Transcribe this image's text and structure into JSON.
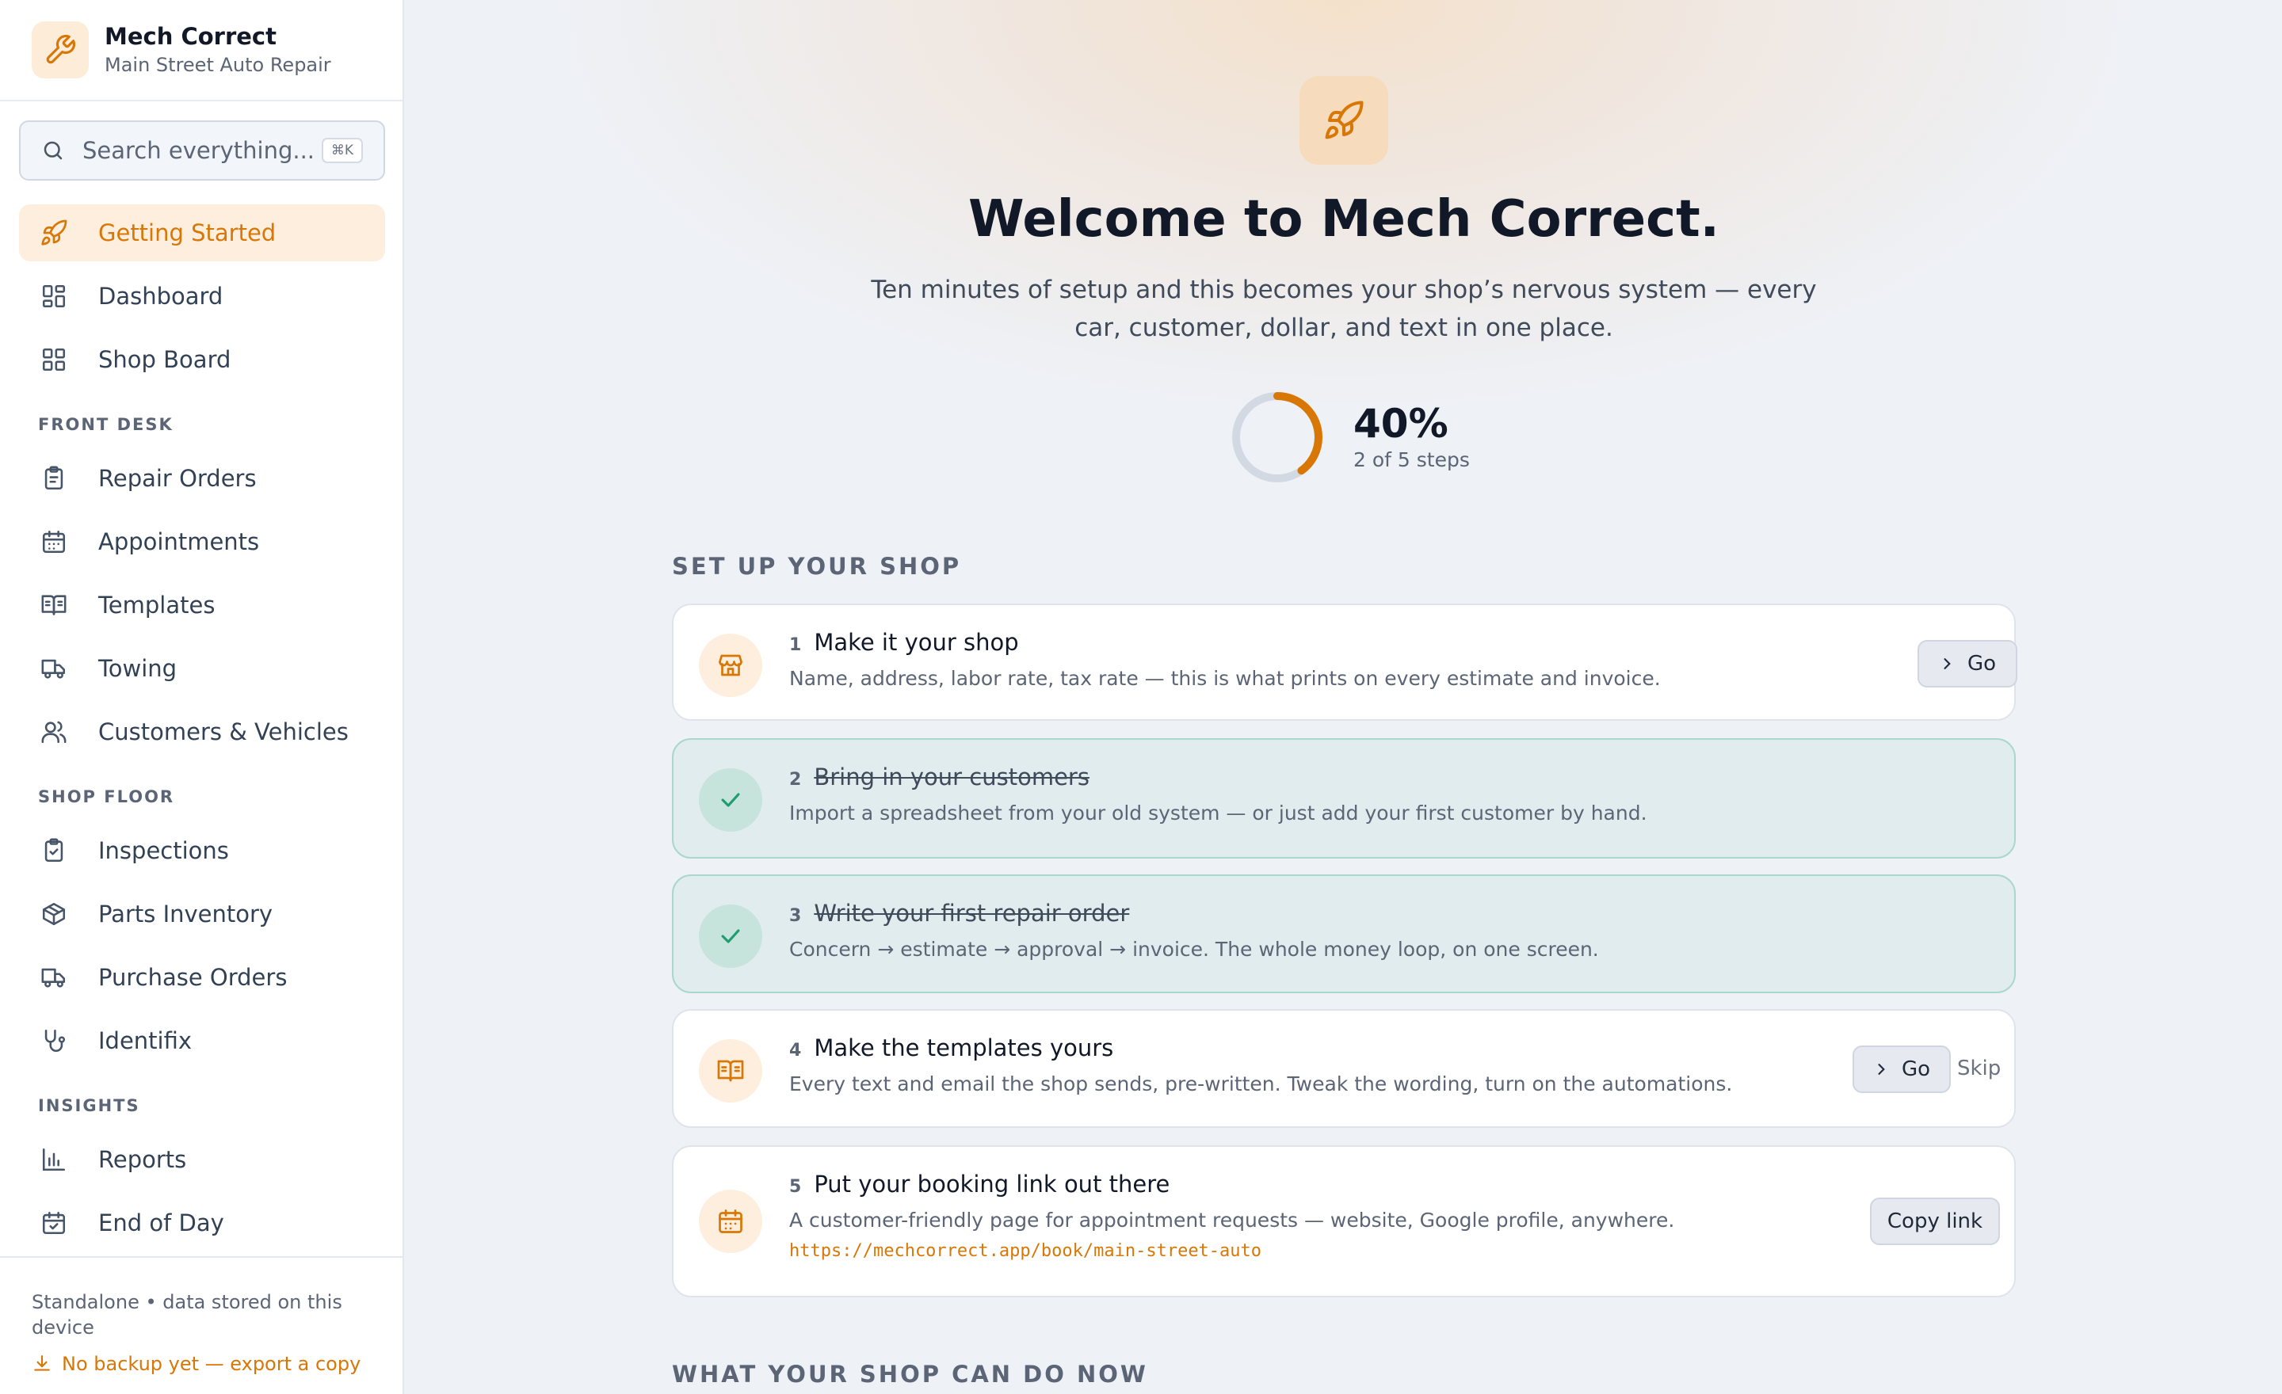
{
  "app": {
    "name": "Mech Correct",
    "shop_name": "Main Street Auto Repair"
  },
  "search": {
    "placeholder": "Search everything...",
    "shortcut": "⌘K"
  },
  "nav": {
    "top": [
      {
        "label": "Getting Started",
        "icon": "rocket-icon",
        "active": true
      },
      {
        "label": "Dashboard",
        "icon": "grid-icon"
      },
      {
        "label": "Shop Board",
        "icon": "grid-icon"
      }
    ],
    "front_desk": {
      "title": "FRONT DESK",
      "items": [
        {
          "label": "Repair Orders",
          "icon": "clipboard-icon"
        },
        {
          "label": "Appointments",
          "icon": "calendar-icon"
        },
        {
          "label": "Templates",
          "icon": "book-icon"
        },
        {
          "label": "Towing",
          "icon": "truck-icon"
        },
        {
          "label": "Customers & Vehicles",
          "icon": "users-icon"
        }
      ]
    },
    "shop_floor": {
      "title": "SHOP FLOOR",
      "items": [
        {
          "label": "Inspections",
          "icon": "clipboard-check-icon"
        },
        {
          "label": "Parts Inventory",
          "icon": "package-icon"
        },
        {
          "label": "Purchase Orders",
          "icon": "truck-icon"
        },
        {
          "label": "Identifix",
          "icon": "stethoscope-icon"
        }
      ]
    },
    "insights": {
      "title": "INSIGHTS",
      "items": [
        {
          "label": "Reports",
          "icon": "bar-chart-icon"
        },
        {
          "label": "End of Day",
          "icon": "calendar-check-icon"
        }
      ]
    }
  },
  "footer": {
    "status": "Standalone • data stored on this device",
    "backup": "No backup yet — export a copy"
  },
  "hero": {
    "title": "Welcome to Mech Correct.",
    "subtitle": "Ten minutes of setup and this becomes your shop’s nervous system — every car, customer, dollar, and text in one place."
  },
  "progress": {
    "percent_label": "40%",
    "fraction": 0.4,
    "steps_label": "2 of 5 steps"
  },
  "setup": {
    "title": "SET UP YOUR SHOP",
    "steps": [
      {
        "num": "1",
        "title": "Make it your shop",
        "desc": "Name, address, labor rate, tax rate — this is what prints on every estimate and invoice.",
        "done": false,
        "icon": "store-icon",
        "action": "Go"
      },
      {
        "num": "2",
        "title": "Bring in your customers",
        "desc": "Import a spreadsheet from your old system — or just add your first customer by hand.",
        "done": true,
        "icon": "check-icon"
      },
      {
        "num": "3",
        "title": "Write your first repair order",
        "desc": "Concern → estimate → approval → invoice. The whole money loop, on one screen.",
        "done": true,
        "icon": "check-icon"
      },
      {
        "num": "4",
        "title": "Make the templates yours",
        "desc": "Every text and email the shop sends, pre-written. Tweak the wording, turn on the automations.",
        "done": false,
        "icon": "book-icon",
        "action": "Go",
        "secondary": "Skip"
      },
      {
        "num": "5",
        "title": "Put your booking link out there",
        "desc": "A customer-friendly page for appointment requests — website, Google profile, anywhere.",
        "link": "https://mechcorrect.app/book/main-street-auto",
        "done": false,
        "icon": "calendar-icon",
        "action": "Copy link"
      }
    ]
  },
  "capabilities": {
    "title": "WHAT YOUR SHOP CAN DO NOW"
  },
  "colors": {
    "accent": "#d97706",
    "accent_soft": "#fdeede",
    "done_bg": "#e1ecee",
    "done_check": "#1f9d6f"
  }
}
